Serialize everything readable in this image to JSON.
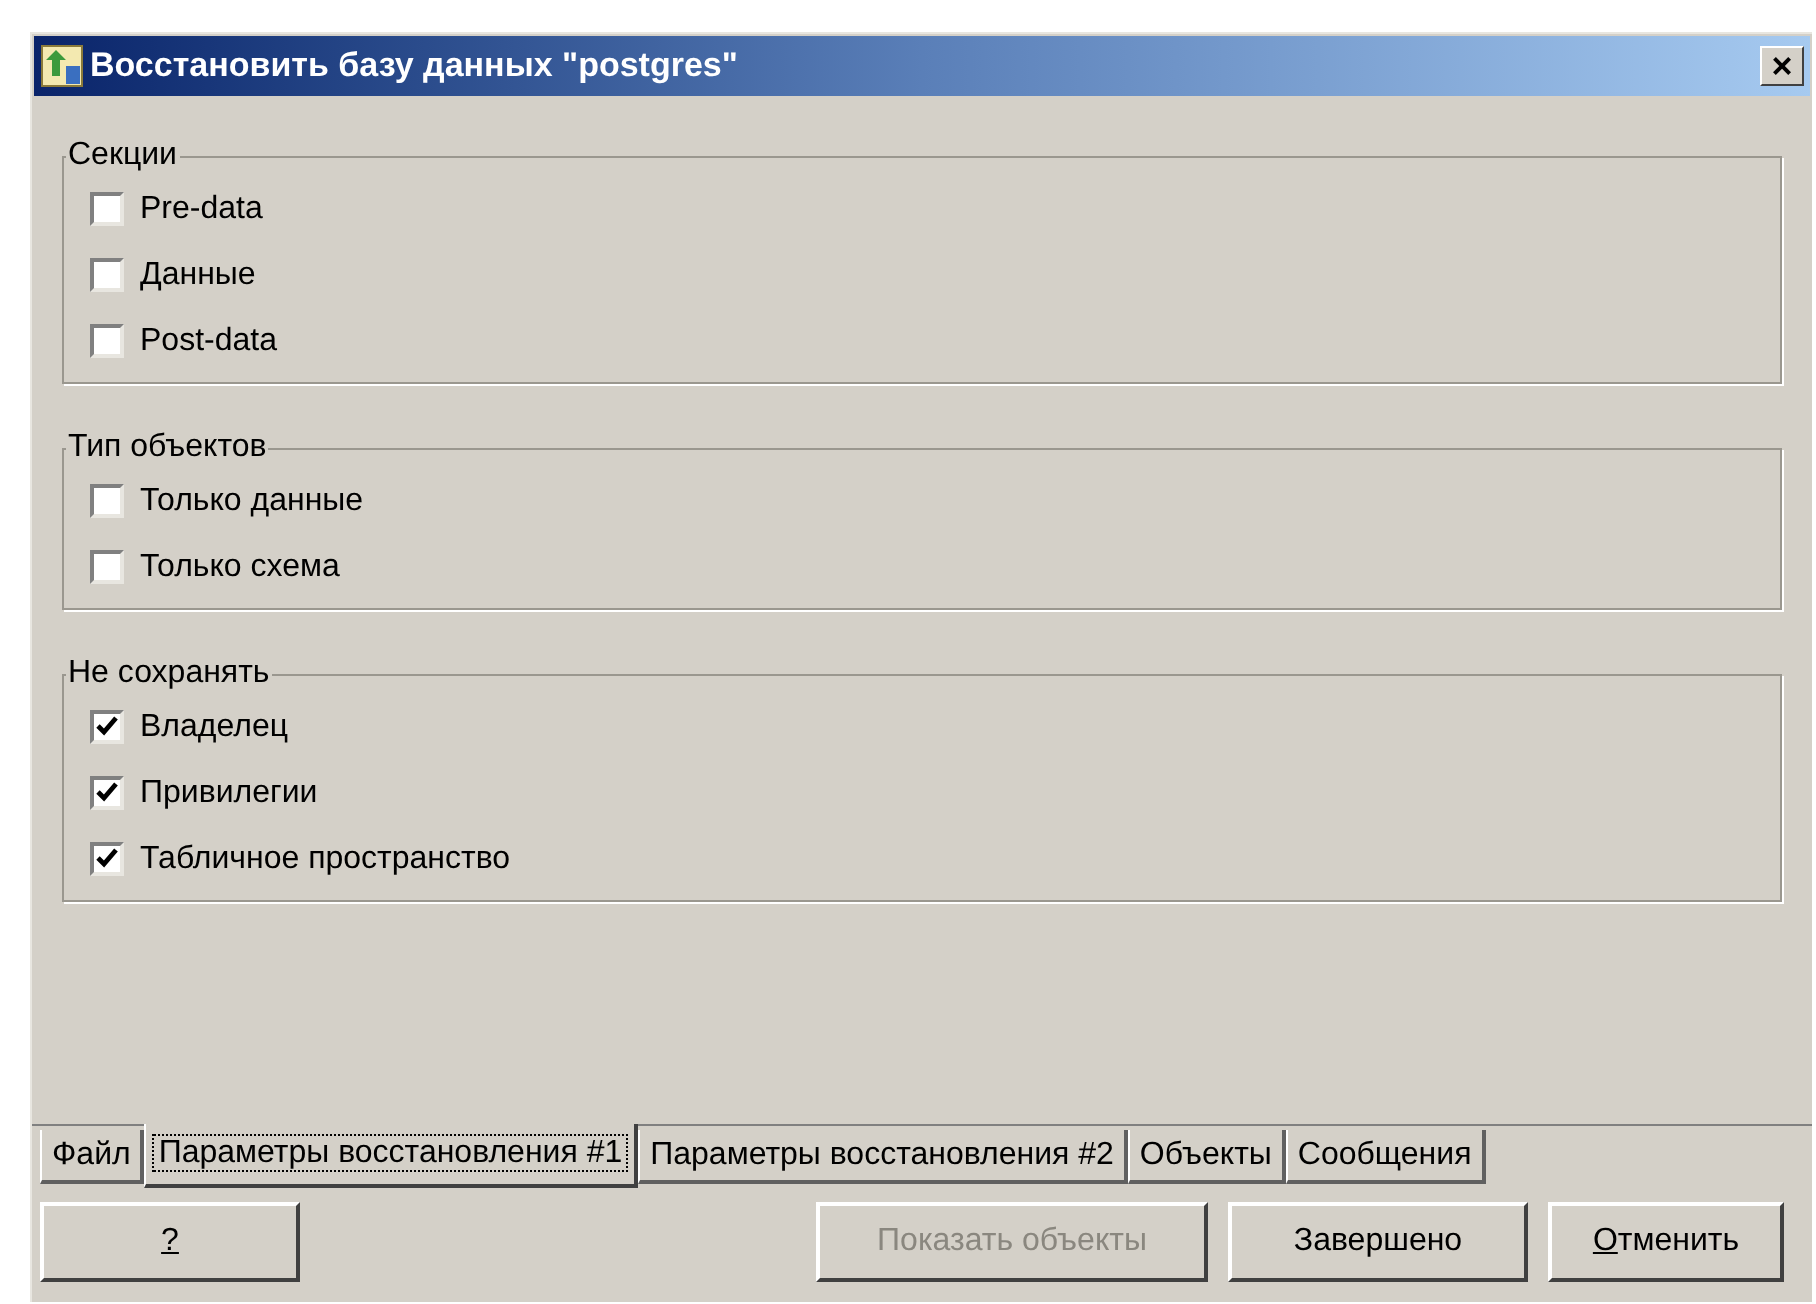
{
  "window": {
    "title": "Восстановить базу данных \"postgres\"",
    "close": "×"
  },
  "groups": [
    {
      "title": "Секции",
      "options": [
        {
          "label": "Pre-data",
          "checked": false
        },
        {
          "label": "Данные",
          "checked": false
        },
        {
          "label": "Post-data",
          "checked": false
        }
      ]
    },
    {
      "title": "Тип объектов",
      "options": [
        {
          "label": "Только данные",
          "checked": false
        },
        {
          "label": "Только схема",
          "checked": false
        }
      ]
    },
    {
      "title": "Не сохранять",
      "options": [
        {
          "label": "Владелец",
          "checked": true
        },
        {
          "label": "Привилегии",
          "checked": true
        },
        {
          "label": "Табличное пространство",
          "checked": true
        }
      ]
    }
  ],
  "tabs": [
    {
      "label": "Файл",
      "selected": false
    },
    {
      "label": "Параметры восстановления #1",
      "selected": true
    },
    {
      "label": "Параметры восстановления #2",
      "selected": false
    },
    {
      "label": "Объекты",
      "selected": false
    },
    {
      "label": "Сообщения",
      "selected": false
    }
  ],
  "buttons": [
    {
      "label": "?",
      "disabled": false,
      "mnemonic": true
    },
    {
      "label": "Показать объекты",
      "disabled": true,
      "mnemonic": false
    },
    {
      "label": "Завершено",
      "disabled": false,
      "mnemonic": false
    },
    {
      "label": "Отменить",
      "disabled": false,
      "mnemonic": true
    }
  ]
}
